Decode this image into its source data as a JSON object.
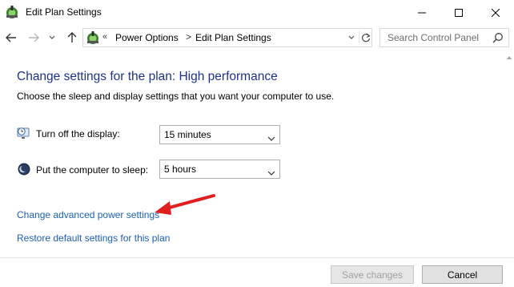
{
  "window": {
    "title": "Edit Plan Settings",
    "icon": "power-options-icon"
  },
  "navigation": {
    "back_icon": "back-arrow-icon",
    "forward_icon": "forward-arrow-icon",
    "recent_icon": "chevron-down-icon",
    "up_icon": "up-arrow-icon",
    "address": {
      "icon": "control-panel-icon",
      "overflow": "«",
      "crumbs": [
        "Power Options",
        "Edit Plan Settings"
      ],
      "separator": ">"
    },
    "search": {
      "placeholder": "Search Control Panel"
    }
  },
  "content": {
    "heading": "Change settings for the plan: High performance",
    "subtitle": "Choose the sleep and display settings that you want your computer to use.",
    "settings": [
      {
        "label": "Turn off the display:",
        "value": "15 minutes",
        "icon": "display-clock-icon"
      },
      {
        "label": "Put the computer to sleep:",
        "value": "5 hours",
        "icon": "sleep-moon-icon"
      }
    ],
    "links": {
      "advanced": "Change advanced power settings",
      "restore": "Restore default settings for this plan"
    }
  },
  "footer": {
    "save_label": "Save changes",
    "cancel_label": "Cancel"
  },
  "colors": {
    "heading": "#1e3287",
    "link": "#1a5fb4",
    "annotation_arrow": "#e0201f"
  }
}
